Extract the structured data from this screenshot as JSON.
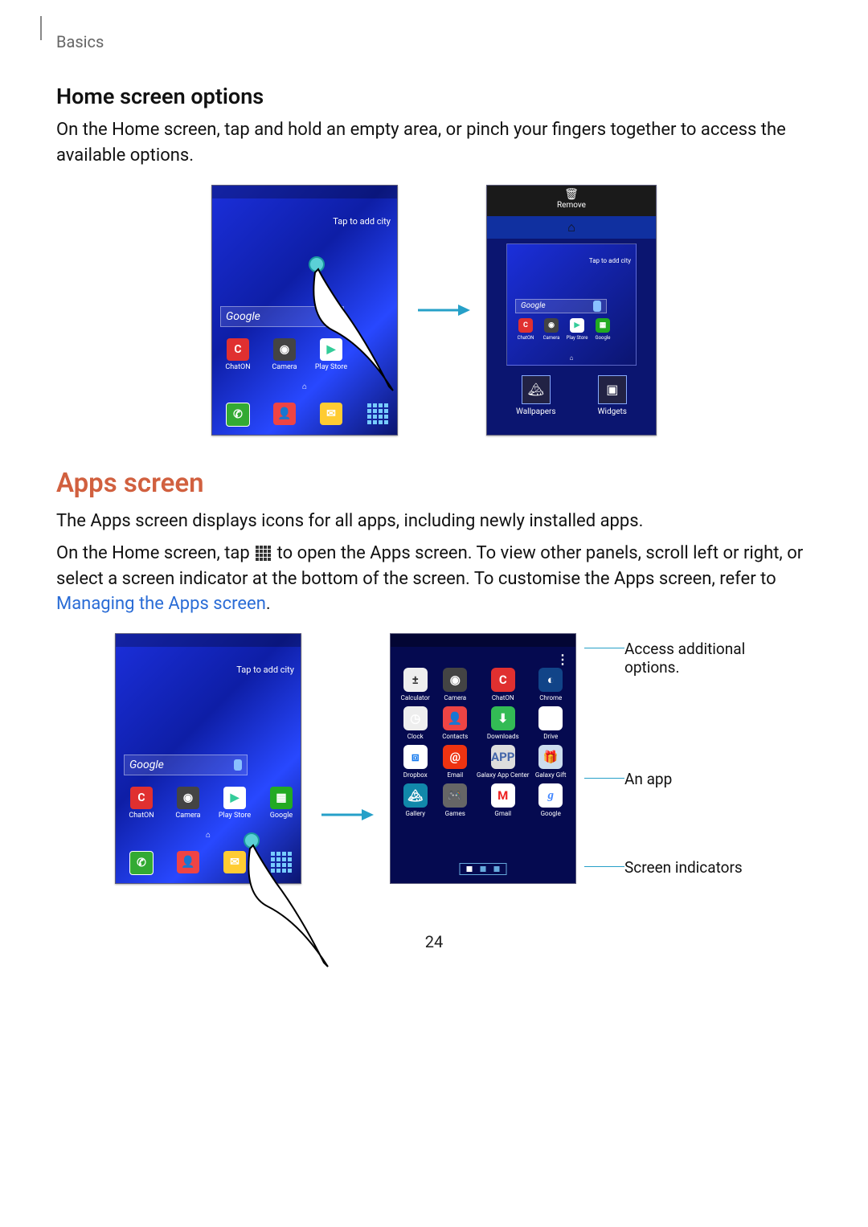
{
  "header": {
    "chapter": "Basics"
  },
  "section1": {
    "title": "Home screen options",
    "body": "On the Home screen, tap and hold an empty area, or pinch your fingers together to access the available options."
  },
  "section2": {
    "title": "Apps screen",
    "p1": "The Apps screen displays icons for all apps, including newly installed apps.",
    "p2a": "On the Home screen, tap ",
    "p2b": " to open the Apps screen. To view other panels, scroll left or right, or select a screen indicator at the bottom of the screen. To customise the Apps screen, refer to ",
    "link": "Managing the Apps screen",
    "period": "."
  },
  "fig1": {
    "left": {
      "tap_city": "Tap to add city",
      "google": "Google",
      "apps_r1": [
        "ChatON",
        "Camera",
        "Play Store"
      ]
    },
    "right": {
      "remove": "Remove",
      "tap_city": "Tap to add city",
      "google": "Google",
      "thumb_apps": [
        "ChatON",
        "Camera",
        "Play Store",
        "Google"
      ],
      "opts": [
        "Wallpapers",
        "Widgets"
      ]
    }
  },
  "fig2": {
    "left": {
      "tap_city": "Tap to add city",
      "google": "Google",
      "apps_r1": [
        "ChatON",
        "Camera",
        "Play Store",
        "Google"
      ]
    },
    "right": {
      "apps": [
        "Calculator",
        "Camera",
        "ChatON",
        "Chrome",
        "Clock",
        "Contacts",
        "Downloads",
        "Drive",
        "Dropbox",
        "Email",
        "Galaxy App Center",
        "Galaxy Gift",
        "Gallery",
        "Games",
        "Gmail",
        "Google"
      ]
    },
    "callouts": {
      "c1": "Access additional options.",
      "c2": "An app",
      "c3": "Screen indicators"
    }
  },
  "page_number": "24"
}
